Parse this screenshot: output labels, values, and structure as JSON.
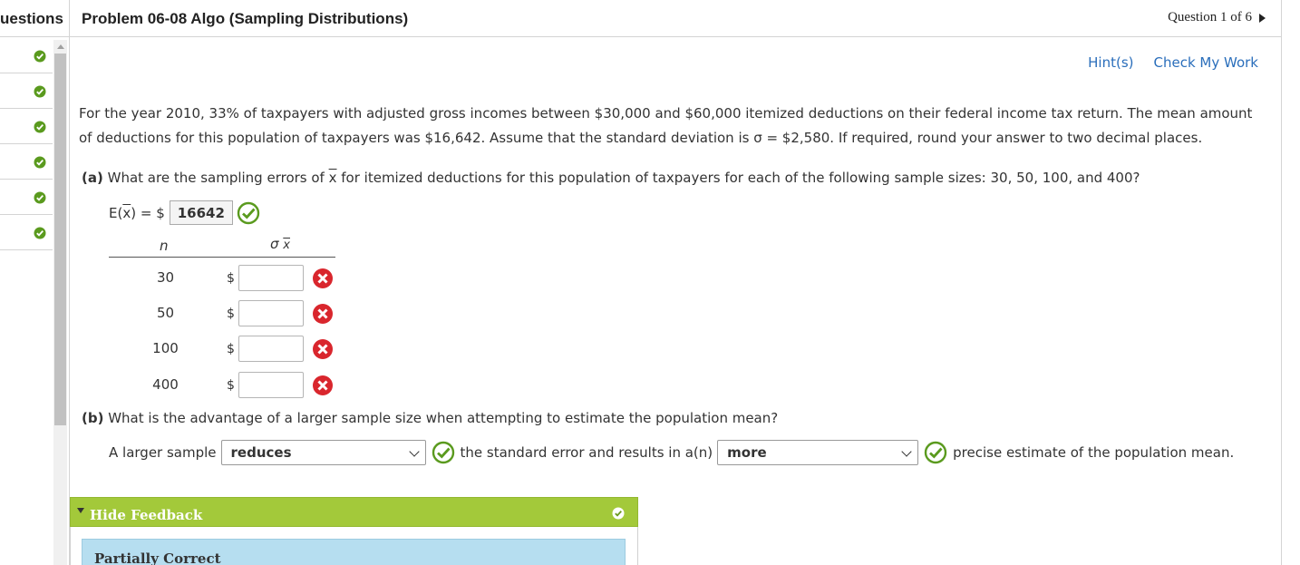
{
  "header": {
    "questions_label": "uestions",
    "problem_title": "Problem 06-08 Algo (Sampling Distributions)",
    "question_nav": "Question 1 of 6"
  },
  "links": {
    "hint": "Hint(s)",
    "check": "Check My Work"
  },
  "intro": "For the year 2010, 33% of taxpayers with adjusted gross incomes between $30,000 and $60,000 itemized deductions on their federal income tax return. The mean amount of deductions for this population of taxpayers was $16,642. Assume that the standard deviation is σ = $2,580. If required, round your answer to two decimal places.",
  "part_a": {
    "label": "(a)",
    "text_before": " What are the sampling errors of ",
    "xbar": "x",
    "text_after": " for itemized deductions for this population of taxpayers for each of the following sample sizes: 30, 50, 100, and 400?",
    "ex_prefix": "E(",
    "ex_x": "x",
    "ex_suffix": ") = $",
    "ex_value": "16642",
    "col_n": "n",
    "col_sigma": "σ",
    "col_sigma_x": "x",
    "dollar": "$",
    "rows": [
      {
        "n": "30",
        "value": ""
      },
      {
        "n": "50",
        "value": ""
      },
      {
        "n": "100",
        "value": ""
      },
      {
        "n": "400",
        "value": ""
      }
    ]
  },
  "part_b": {
    "label": "(b)",
    "question": " What is the advantage of a larger sample size when attempting to estimate the population mean?",
    "prefix": "A larger sample",
    "select1": "reduces",
    "middle": "the standard error and results in a(n)",
    "select2": "more",
    "suffix": "precise estimate of the population mean."
  },
  "feedback": {
    "toggle": "Hide Feedback",
    "status": "Partially Correct"
  },
  "colors": {
    "correct": "#5a9a1e",
    "incorrect": "#d9262d",
    "link": "#2a6ebb",
    "feedback_bar": "#a3c93a",
    "feedback_box": "#b6def0"
  },
  "icons": [
    "check-circle-icon",
    "x-circle-icon",
    "chevron-down-icon",
    "triangle-right-icon",
    "triangle-down-icon",
    "check-badge-icon"
  ]
}
